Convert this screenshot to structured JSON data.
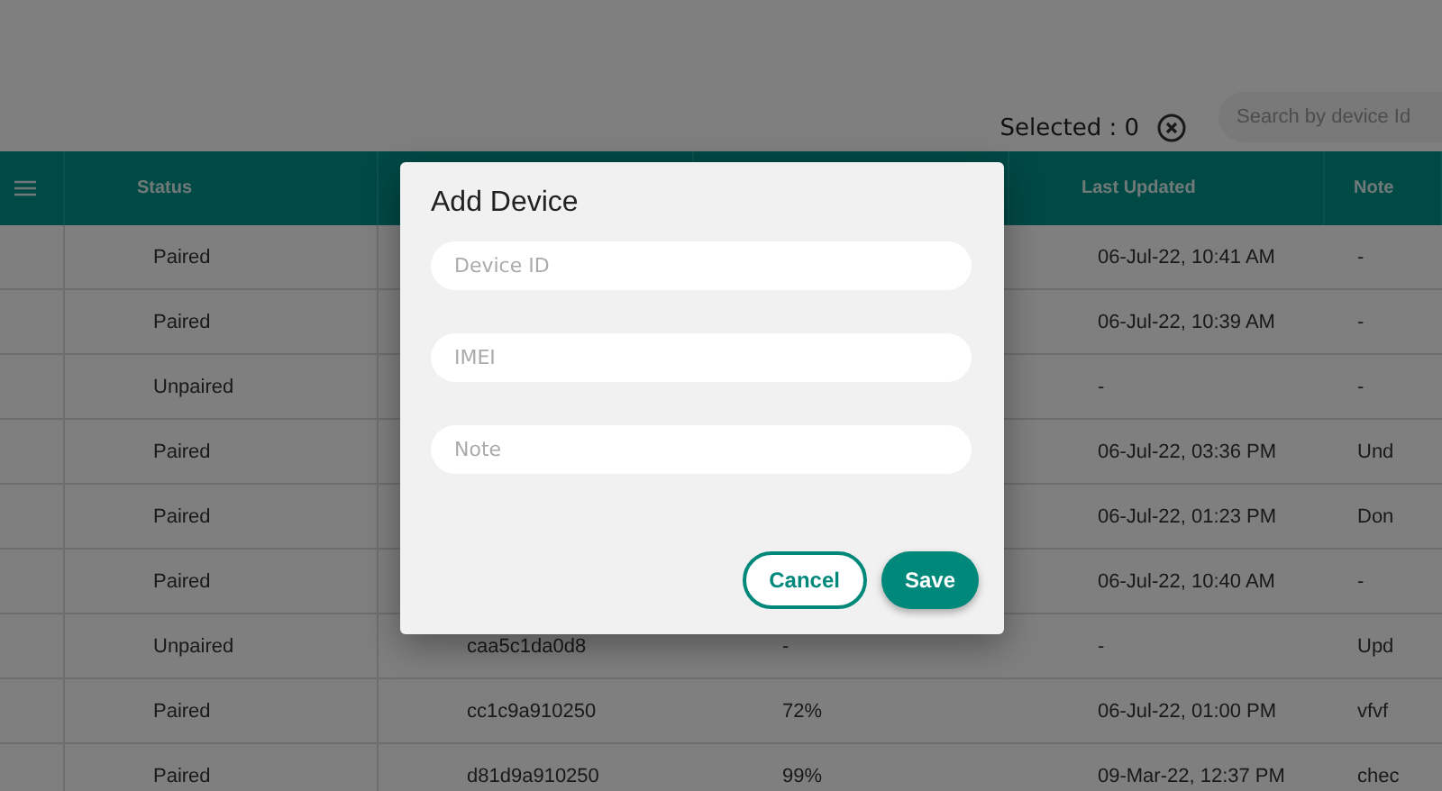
{
  "toolbar": {
    "selected_label": "Selected : 0",
    "search": {
      "placeholder": "Search by device Id"
    }
  },
  "table": {
    "columns": [
      "Status",
      "Last Updated",
      "Note"
    ],
    "rows": [
      {
        "status": "Paired",
        "last_updated": "06-Jul-22, 10:41 AM",
        "note": "-"
      },
      {
        "status": "Paired",
        "last_updated": "06-Jul-22, 10:39 AM",
        "note": "-"
      },
      {
        "status": "Unpaired",
        "last_updated": "-",
        "note": "-"
      },
      {
        "status": "Paired",
        "last_updated": "06-Jul-22, 03:36 PM",
        "note": "Und"
      },
      {
        "status": "Paired",
        "last_updated": "06-Jul-22, 01:23 PM",
        "note": "Don"
      },
      {
        "status": "Paired",
        "last_updated": "06-Jul-22, 10:40 AM",
        "note": "-"
      },
      {
        "status": "Unpaired",
        "column_3": "caa5c1da0d8",
        "column_4": "-",
        "last_updated": "-",
        "note": "Upd"
      },
      {
        "status": "Paired",
        "column_3": "cc1c9a910250",
        "column_4": "72%",
        "last_updated": "06-Jul-22, 01:00 PM",
        "note": "vfvf"
      },
      {
        "status": "Paired",
        "column_3": "d81d9a910250",
        "column_4": "99%",
        "last_updated": "09-Mar-22, 12:37 PM",
        "note": "chec"
      }
    ]
  },
  "dialog": {
    "title": "Add Device",
    "fields": [
      {
        "placeholder": "Device ID"
      },
      {
        "placeholder": "IMEI"
      },
      {
        "placeholder": "Note"
      }
    ],
    "buttons": [
      {
        "label": "Cancel",
        "kind": "outlined"
      },
      {
        "label": "Save",
        "kind": "filled"
      }
    ]
  }
}
